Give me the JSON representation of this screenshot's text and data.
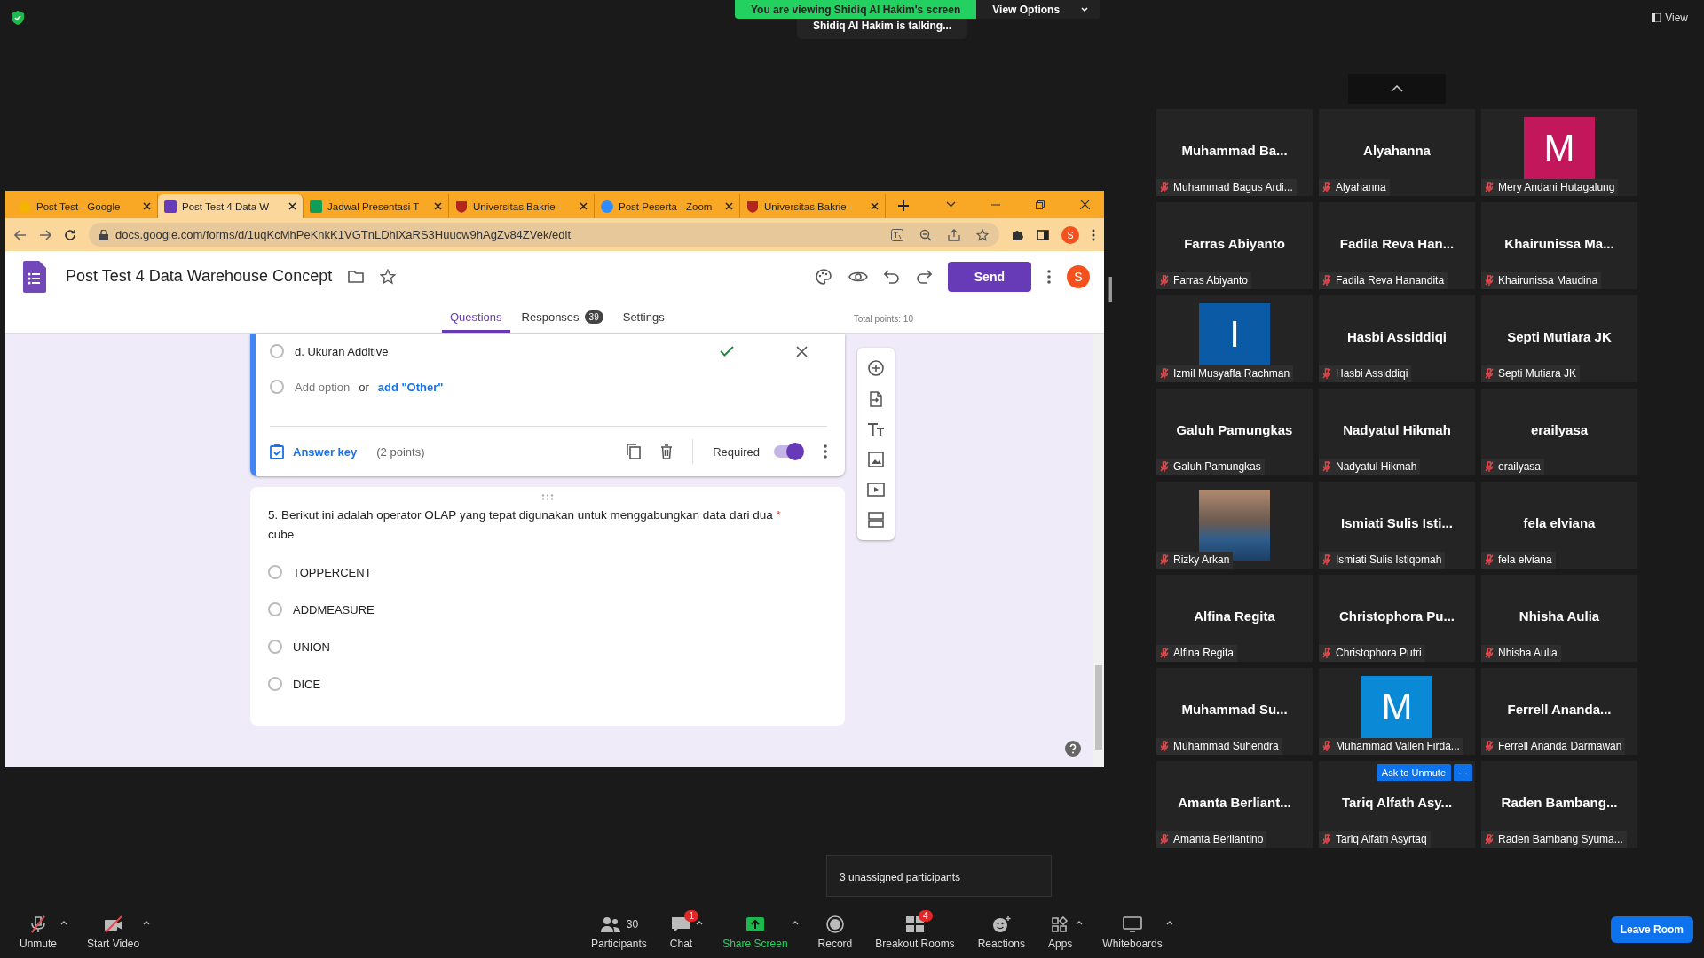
{
  "banner": {
    "text": "You are viewing Shidiq Al Hakim's screen",
    "options": "View Options",
    "talking": "Shidiq Al Hakim is talking..."
  },
  "view_button": "View",
  "browser": {
    "tabs": [
      {
        "title": "Post Test - Google",
        "kind": "drive",
        "selected": false
      },
      {
        "title": "Post Test 4 Data W",
        "kind": "forms",
        "selected": true
      },
      {
        "title": "Jadwal Presentasi T",
        "kind": "sheets",
        "selected": false
      },
      {
        "title": "Universitas Bakrie -",
        "kind": "shield",
        "selected": false
      },
      {
        "title": "Post Peserta - Zoom",
        "kind": "zoom",
        "selected": false
      },
      {
        "title": "Universitas Bakrie -",
        "kind": "shield",
        "selected": false
      }
    ],
    "url": "docs.google.com/forms/d/1uqKcMhPeKnkK1VGTnLDhlXaRS3Huucw9hAgZv84ZVek/edit",
    "profile": "S"
  },
  "form": {
    "title": "Post Test 4 Data Warehouse Concept",
    "send": "Send",
    "avatar": "S",
    "tabs": [
      {
        "label": "Questions",
        "selected": true
      },
      {
        "label": "Responses",
        "selected": false,
        "badge": "39"
      },
      {
        "label": "Settings",
        "selected": false
      }
    ],
    "total_points": "Total points: 10",
    "question_4": {
      "option": {
        "label": "d. Ukuran Additive",
        "selected": false
      },
      "correct": true,
      "add_option": "Add option",
      "or": "or",
      "add_other": "add \"Other\"",
      "answer_key": "Answer key",
      "points": "(2 points)",
      "required_label": "Required",
      "required": true
    },
    "question_5": {
      "text": "5. Berikut ini adalah operator OLAP yang tepat digunakan untuk menggabungkan data dari dua",
      "text_end": "cube",
      "required_mark": "*",
      "options": [
        {
          "label": "TOPPERCENT",
          "selected": false
        },
        {
          "label": "ADDMEASURE",
          "selected": false
        },
        {
          "label": "UNION",
          "selected": false
        },
        {
          "label": "DICE",
          "selected": false
        }
      ]
    }
  },
  "participants": [
    {
      "display": "Muhammad Ba...",
      "label": "Muhammad Bagus Ardi...",
      "kind": "name"
    },
    {
      "display": "Alyahanna",
      "label": "Alyahanna",
      "kind": "name"
    },
    {
      "display": "M",
      "label": "Mery Andani Hutagalung",
      "kind": "letter",
      "color": "#c2185b"
    },
    {
      "display": "Farras Abiyanto",
      "label": "Farras Abiyanto",
      "kind": "name"
    },
    {
      "display": "Fadila Reva Han...",
      "label": "Fadila Reva Hanandita",
      "kind": "name"
    },
    {
      "display": "Khairunissa Ma...",
      "label": "Khairunissa Maudina",
      "kind": "name"
    },
    {
      "display": "I",
      "label": "Izmil Musyaffa Rachman",
      "kind": "letter",
      "color": "#0b5aa6"
    },
    {
      "display": "Hasbi Assiddiqi",
      "label": "Hasbi Assiddiqi",
      "kind": "name"
    },
    {
      "display": "Septi Mutiara JK",
      "label": "Septi Mutiara JK",
      "kind": "name"
    },
    {
      "display": "Galuh Pamungkas",
      "label": "Galuh Pamungkas",
      "kind": "name"
    },
    {
      "display": "Nadyatul Hikmah",
      "label": "Nadyatul Hikmah",
      "kind": "name"
    },
    {
      "display": "erailyasa",
      "label": "erailyasa",
      "kind": "name"
    },
    {
      "label": "Rizky Arkan",
      "kind": "photo"
    },
    {
      "display": "Ismiati Sulis Isti...",
      "label": "Ismiati Sulis Istiqomah",
      "kind": "name"
    },
    {
      "display": "fela elviana",
      "label": "fela elviana",
      "kind": "name"
    },
    {
      "display": "Alfina Regita",
      "label": "Alfina Regita",
      "kind": "name"
    },
    {
      "display": "Christophora Pu...",
      "label": "Christophora Putri",
      "kind": "name"
    },
    {
      "display": "Nhisha Aulia",
      "label": "Nhisha Aulia",
      "kind": "name"
    },
    {
      "display": "Muhammad Su...",
      "label": "Muhammad Suhendra",
      "kind": "name"
    },
    {
      "display": "M",
      "label": "Muhammad Vallen Firda...",
      "kind": "letter",
      "color": "#0a8ad6"
    },
    {
      "display": "Ferrell Ananda...",
      "label": "Ferrell Ananda Darmawan",
      "kind": "name"
    },
    {
      "display": "Amanta Berliant...",
      "label": "Amanta Berliantino",
      "kind": "name"
    },
    {
      "display": "Tariq Alfath Asy...",
      "label": "Tariq Alfath Asyrtaq",
      "kind": "name",
      "ask_unmute": "Ask to Unmute",
      "more": "···"
    },
    {
      "display": "Raden Bambang...",
      "label": "Raden Bambang Syuma...",
      "kind": "name"
    }
  ],
  "toast": "3 unassigned participants",
  "toolbar": [
    {
      "label": "Unmute",
      "kind": "mic",
      "caret": true
    },
    {
      "label": "Start Video",
      "kind": "video",
      "caret": true
    },
    {
      "label": "Participants",
      "kind": "people",
      "count": "30",
      "caret": false
    },
    {
      "label": "Chat",
      "kind": "chat",
      "badge": "1",
      "caret": true
    },
    {
      "label": "Share Screen",
      "kind": "share",
      "caret": true
    },
    {
      "label": "Record",
      "kind": "record",
      "caret": false
    },
    {
      "label": "Breakout Rooms",
      "kind": "rooms",
      "badge": "4",
      "caret": false
    },
    {
      "label": "Reactions",
      "kind": "reactions",
      "caret": false
    },
    {
      "label": "Apps",
      "kind": "apps",
      "caret": true
    },
    {
      "label": "Whiteboards",
      "kind": "board",
      "caret": true
    }
  ],
  "leave": "Leave Room"
}
